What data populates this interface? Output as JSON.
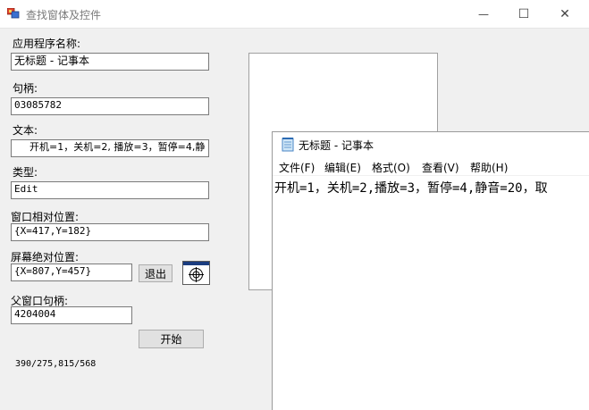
{
  "window": {
    "title": "查找窗体及控件",
    "minimize_glyph": "—",
    "maximize_glyph": "☐",
    "close_glyph": "✕"
  },
  "form": {
    "app_name_label": "应用程序名称:",
    "app_name_value": "无标题 - 记事本",
    "handle_label": "句柄:",
    "handle_value": "03085782",
    "text_label": "文本:",
    "text_value": "开机=1，关机=2, 播放=3，暂停=4,静",
    "type_label": "类型:",
    "type_value": "Edit",
    "relative_pos_label": "窗口相对位置:",
    "relative_pos_value": "{X=417,Y=182}",
    "screen_pos_label": "屏幕绝对位置:",
    "screen_pos_value": "{X=807,Y=457}",
    "exit_button": "退出",
    "parent_handle_label": "父窗口句柄:",
    "parent_handle_value": "4204004",
    "start_button": "开始",
    "status": "390/275,815/568"
  },
  "notepad": {
    "title": "无标题 - 记事本",
    "menu": [
      "文件(F)",
      "编辑(E)",
      "格式(O)",
      "查看(V)",
      "帮助(H)"
    ],
    "content": "开机=1，关机=2,播放=3，暂停=4,静音=20，取"
  },
  "icons": {
    "app": "app-window-icon",
    "notepad": "notepad-icon",
    "crosshair": "crosshair-target-icon"
  }
}
